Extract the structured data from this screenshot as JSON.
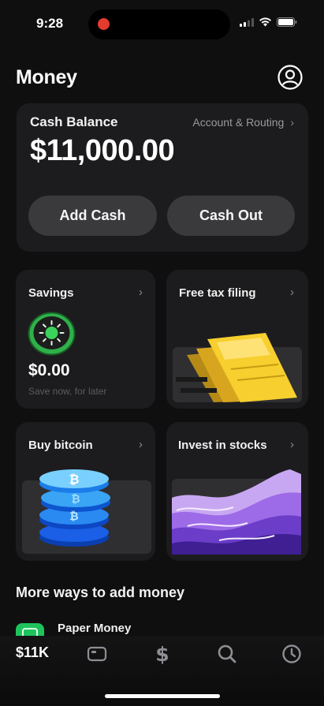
{
  "status_bar": {
    "time": "9:28"
  },
  "header": {
    "title": "Money"
  },
  "balance": {
    "label": "Cash Balance",
    "routing_link": "Account & Routing",
    "amount": "$11,000.00",
    "add_cash": "Add Cash",
    "cash_out": "Cash Out"
  },
  "tiles": [
    {
      "title": "Savings",
      "amount": "$0.00",
      "subtitle": "Save now, for later"
    },
    {
      "title": "Free tax filing"
    },
    {
      "title": "Buy bitcoin"
    },
    {
      "title": "Invest in stocks"
    }
  ],
  "more_ways": {
    "heading": "More ways to add money",
    "items": [
      {
        "label": "Paper Money",
        "icon": "paper-money-icon"
      }
    ]
  },
  "tab_bar": {
    "money_label": "$11K",
    "icons": [
      "card-icon",
      "dollar-icon",
      "search-icon",
      "activity-clock-icon"
    ]
  },
  "colors": {
    "background": "#0f0f10",
    "card": "#1c1c1e",
    "button": "#3a3a3c",
    "accent_green": "#1fc35c"
  }
}
